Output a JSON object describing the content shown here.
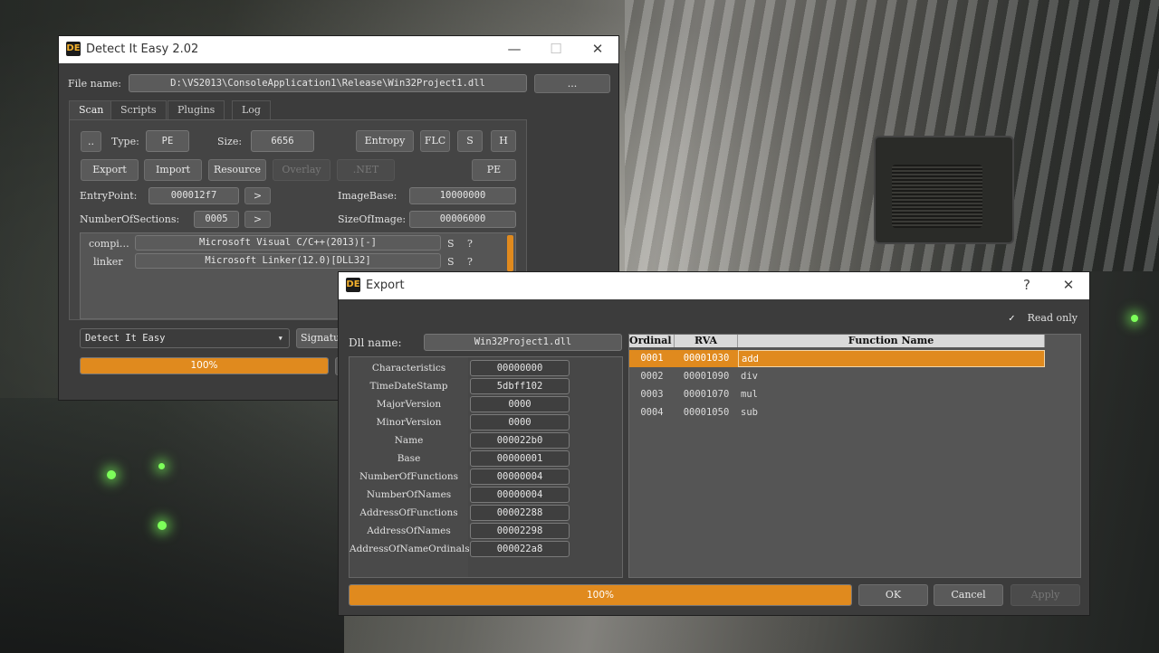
{
  "die": {
    "title": "Detect It Easy 2.02",
    "file_name_label": "File name:",
    "file_path": "D:\\VS2013\\ConsoleApplication1\\Release\\Win32Project1.dll",
    "browse_label": "...",
    "tabs": [
      "Scan",
      "Scripts",
      "Plugins",
      "Log"
    ],
    "more_label": "..",
    "type_label": "Type:",
    "type_value": "PE",
    "size_label": "Size:",
    "size_value": "6656",
    "entropy_label": "Entropy",
    "flc_label": "FLC",
    "s_label": "S",
    "h_label": "H",
    "export_label": "Export",
    "import_label": "Import",
    "resource_label": "Resource",
    "overlay_label": "Overlay",
    "net_label": ".NET",
    "pe_label": "PE",
    "entrypoint_label": "EntryPoint:",
    "entrypoint_value": "000012f7",
    "imagebase_label": "ImageBase:",
    "imagebase_value": "10000000",
    "sections_label": "NumberOfSections:",
    "sections_value": "0005",
    "sizeofimage_label": "SizeOfImage:",
    "sizeofimage_value": "00006000",
    "arrow": ">",
    "results": [
      {
        "type": "compi…",
        "value": "Microsoft Visual C/C++(2013)[-]",
        "s": "S",
        "q": "?"
      },
      {
        "type": "linker",
        "value": "Microsoft Linker(12.0)[DLL32]",
        "s": "S",
        "q": "?"
      }
    ],
    "engine_select": "Detect It Easy",
    "signatures_label": "Signatu",
    "progress_value": 1.0,
    "progress_text": "100%"
  },
  "export": {
    "title": "Export",
    "help": "?",
    "close": "✕",
    "read_only_label": "Read only",
    "read_only_checked": true,
    "dll_name_label": "Dll name:",
    "dll_name_value": "Win32Project1.dll",
    "fields": [
      {
        "label": "Characteristics",
        "value": "00000000"
      },
      {
        "label": "TimeDateStamp",
        "value": "5dbff102"
      },
      {
        "label": "MajorVersion",
        "value": "0000"
      },
      {
        "label": "MinorVersion",
        "value": "0000"
      },
      {
        "label": "Name",
        "value": "000022b0"
      },
      {
        "label": "Base",
        "value": "00000001"
      },
      {
        "label": "NumberOfFunctions",
        "value": "00000004"
      },
      {
        "label": "NumberOfNames",
        "value": "00000004"
      },
      {
        "label": "AddressOfFunctions",
        "value": "00002288"
      },
      {
        "label": "AddressOfNames",
        "value": "00002298"
      },
      {
        "label": "AddressOfNameOrdinals",
        "value": "000022a8"
      }
    ],
    "columns": [
      "Ordinal",
      "RVA",
      "Function Name"
    ],
    "rows": [
      {
        "ordinal": "0001",
        "rva": "00001030",
        "name": "add"
      },
      {
        "ordinal": "0002",
        "rva": "00001090",
        "name": "div"
      },
      {
        "ordinal": "0003",
        "rva": "00001070",
        "name": "mul"
      },
      {
        "ordinal": "0004",
        "rva": "00001050",
        "name": "sub"
      }
    ],
    "progress_value": 1.0,
    "progress_text": "100%",
    "ok_label": "OK",
    "cancel_label": "Cancel",
    "apply_label": "Apply"
  },
  "colors": {
    "accent": "#e08a1e",
    "window_bg": "#3c3c3c",
    "control_bg": "#5a5a5a"
  }
}
